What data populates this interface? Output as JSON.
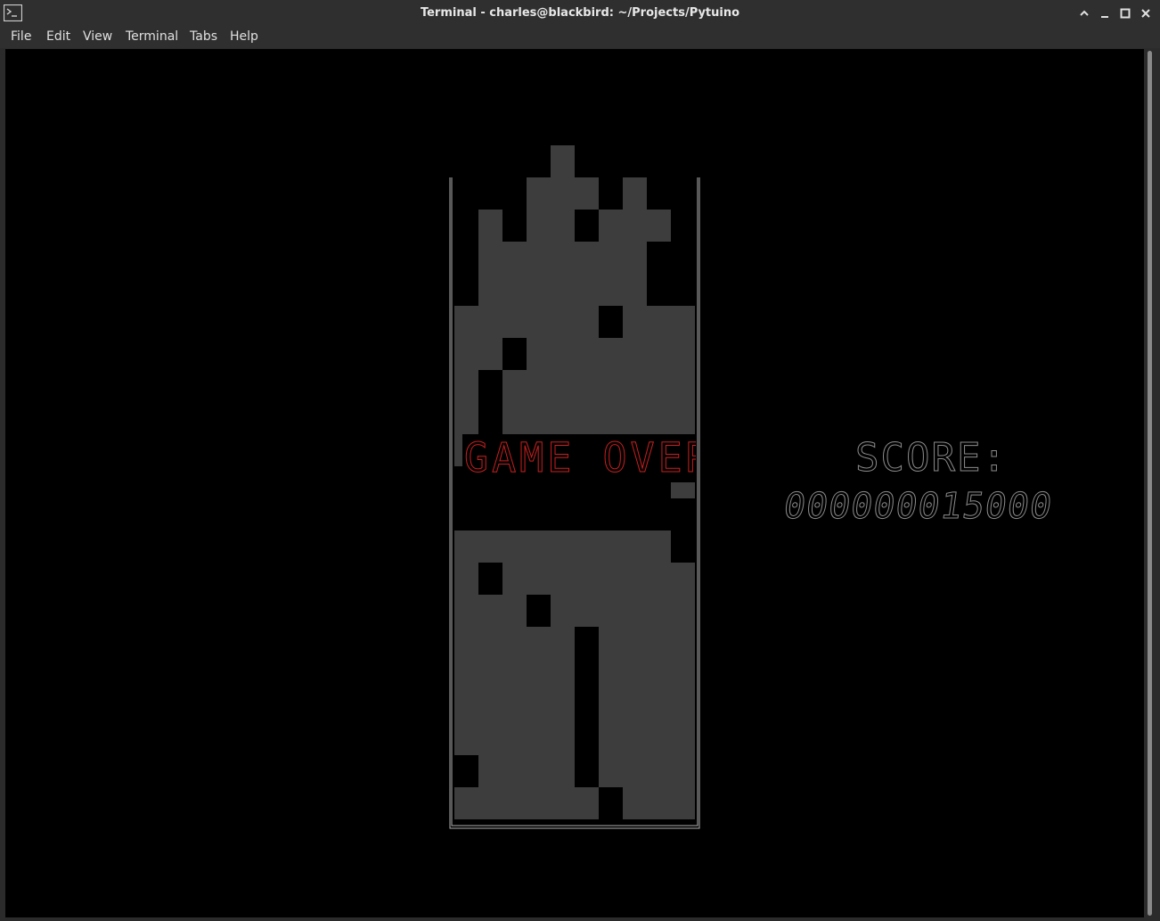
{
  "window": {
    "title": "Terminal - charles@blackbird: ~/Projects/Pytuino",
    "icons": [
      "terminal-icon",
      "maximize-up-icon",
      "minimize-icon",
      "restore-icon",
      "close-icon"
    ]
  },
  "menu": {
    "items": [
      "File",
      "Edit",
      "View",
      "Terminal",
      "Tabs",
      "Help"
    ]
  },
  "game": {
    "game_over_text": "GAME OVER",
    "score_label": "SCORE:",
    "score_value": "000000015000",
    "colors": {
      "block": "#3d3d3d",
      "game_over": "#cc1f1f",
      "score": "#8c8c8c",
      "well_border": "#b0b0b0"
    },
    "board": {
      "columns": 10,
      "rows": 21,
      "cells": [
        "....#.....",
        "...###.#..",
        ".#.##.###.",
        ".#######..",
        ".#######..",
        "######.###",
        "##.#######",
        "#.########",
        "#.########",
        "#########.",
        ".........#",
        "..........",
        "#########.",
        "#.########",
        "###.######",
        "#####.####",
        "#####.####",
        "#####.####",
        "#####.####",
        ".####.####",
        "######.###"
      ]
    }
  }
}
